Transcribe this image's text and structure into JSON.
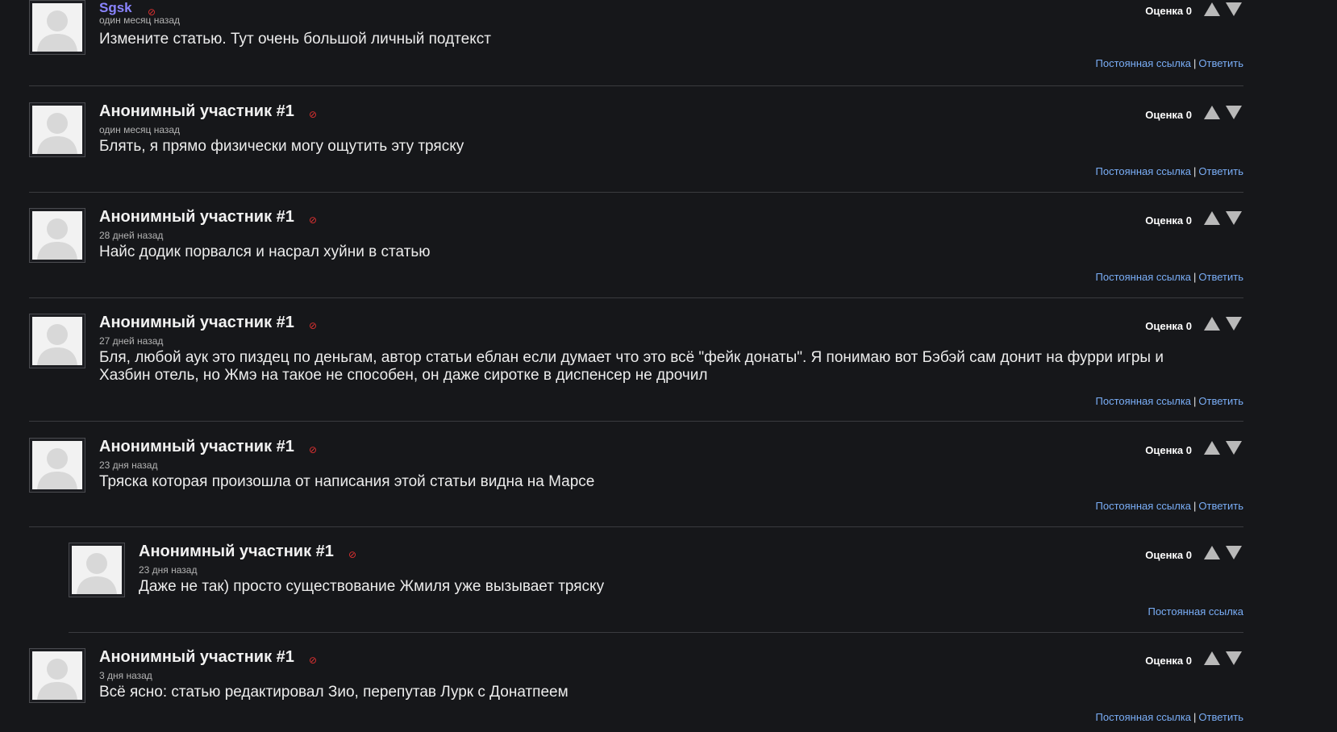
{
  "common": {
    "rating_label": "Оценка 0",
    "permalink_label": "Постоянная ссылка",
    "reply_label": "Ответить",
    "separator": "|",
    "flag_glyph": "⊘"
  },
  "comments": [
    {
      "author": "Sgsk",
      "author_type": "registered",
      "date": "один месяц назад",
      "text": "Измените статью. Тут очень большой личный подтекст",
      "rating": "Оценка 0",
      "has_reply": true
    },
    {
      "author": "Анонимный участник #1",
      "author_type": "anonymous",
      "date": "один месяц назад",
      "text": "Блять, я прямо физически могу ощутить эту тряску",
      "rating": "Оценка 0",
      "has_reply": true
    },
    {
      "author": "Анонимный участник #1",
      "author_type": "anonymous",
      "date": "28 дней назад",
      "text": "Найс додик порвался и насрал хуйни в статью",
      "rating": "Оценка 0",
      "has_reply": true
    },
    {
      "author": "Анонимный участник #1",
      "author_type": "anonymous",
      "date": "27 дней назад",
      "text": "Бля, любой аук это пиздец по деньгам, автор статьи еблан если думает что это всё \"фейк донаты\". Я понимаю вот Бэбэй сам донит на фурри игры и Хазбин отель, но Жмэ на такое не способен, он даже сиротке в диспенсер не дрочил",
      "rating": "Оценка 0",
      "has_reply": true
    },
    {
      "author": "Анонимный участник #1",
      "author_type": "anonymous",
      "date": "23 дня назад",
      "text": "Тряска которая произошла от написания этой статьи видна на Марсе",
      "rating": "Оценка 0",
      "has_reply": true
    },
    {
      "author": "Анонимный участник #1",
      "author_type": "anonymous",
      "date": "23 дня назад",
      "text": "Даже не так) просто существование Жмиля уже вызывает тряску",
      "rating": "Оценка 0",
      "nested": true,
      "has_reply": false
    },
    {
      "author": "Анонимный участник #1",
      "author_type": "anonymous",
      "date": "3 дня назад",
      "text": "Всё ясно: статью редактировал Зио, перепутав Лурк с Донатпеем",
      "rating": "Оценка 0",
      "has_reply": true
    }
  ]
}
